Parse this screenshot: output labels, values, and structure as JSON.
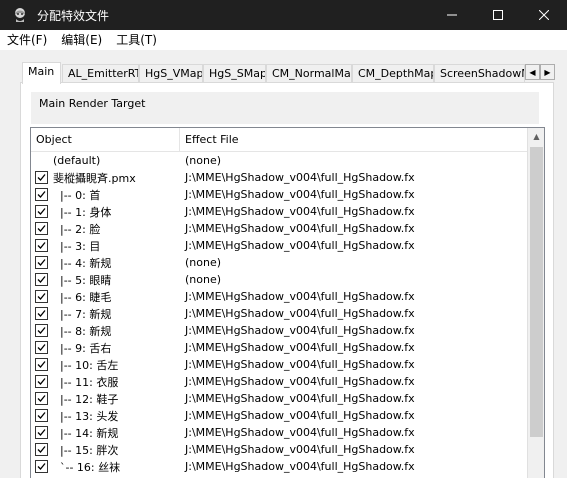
{
  "window": {
    "title": "分配特效文件",
    "minimize_icon": "minimize-icon",
    "maximize_icon": "maximize-icon",
    "close_icon": "close-icon"
  },
  "menu": [
    {
      "label": "文件(F)"
    },
    {
      "label": "编辑(E)"
    },
    {
      "label": "工具(T)"
    }
  ],
  "tabs": [
    {
      "label": "Main",
      "active": true
    },
    {
      "label": "AL_EmitterRT"
    },
    {
      "label": "HgS_VMap"
    },
    {
      "label": "HgS_SMap"
    },
    {
      "label": "CM_NormalMap"
    },
    {
      "label": "CM_DepthMap"
    },
    {
      "label": "ScreenShadowMap"
    }
  ],
  "render_target": {
    "label": "Main Render Target"
  },
  "list": {
    "columns": {
      "object": "Object",
      "effect": "Effect File"
    },
    "rows": [
      {
        "object": "(default)",
        "effect": "(none)",
        "checked": null
      },
      {
        "object": "斐樅攝睍斉.pmx",
        "effect": "J:\\MME\\HgShadow_v004\\full_HgShadow.fx",
        "checked": true
      },
      {
        "object": "  |-- 0: 首",
        "effect": "J:\\MME\\HgShadow_v004\\full_HgShadow.fx",
        "checked": true
      },
      {
        "object": "  |-- 1: 身体",
        "effect": "J:\\MME\\HgShadow_v004\\full_HgShadow.fx",
        "checked": true
      },
      {
        "object": "  |-- 2: 脸",
        "effect": "J:\\MME\\HgShadow_v004\\full_HgShadow.fx",
        "checked": true
      },
      {
        "object": "  |-- 3: 目",
        "effect": "J:\\MME\\HgShadow_v004\\full_HgShadow.fx",
        "checked": true
      },
      {
        "object": "  |-- 4: 新规",
        "effect": "(none)",
        "checked": true
      },
      {
        "object": "  |-- 5: 眼睛",
        "effect": "(none)",
        "checked": true
      },
      {
        "object": "  |-- 6: 睫毛",
        "effect": "J:\\MME\\HgShadow_v004\\full_HgShadow.fx",
        "checked": true
      },
      {
        "object": "  |-- 7: 新规",
        "effect": "J:\\MME\\HgShadow_v004\\full_HgShadow.fx",
        "checked": true
      },
      {
        "object": "  |-- 8: 新规",
        "effect": "J:\\MME\\HgShadow_v004\\full_HgShadow.fx",
        "checked": true
      },
      {
        "object": "  |-- 9: 舌右",
        "effect": "J:\\MME\\HgShadow_v004\\full_HgShadow.fx",
        "checked": true
      },
      {
        "object": "  |-- 10: 舌左",
        "effect": "J:\\MME\\HgShadow_v004\\full_HgShadow.fx",
        "checked": true
      },
      {
        "object": "  |-- 11: 衣服",
        "effect": "J:\\MME\\HgShadow_v004\\full_HgShadow.fx",
        "checked": true
      },
      {
        "object": "  |-- 12: 鞋子",
        "effect": "J:\\MME\\HgShadow_v004\\full_HgShadow.fx",
        "checked": true
      },
      {
        "object": "  |-- 13: 头发",
        "effect": "J:\\MME\\HgShadow_v004\\full_HgShadow.fx",
        "checked": true
      },
      {
        "object": "  |-- 14: 新规",
        "effect": "J:\\MME\\HgShadow_v004\\full_HgShadow.fx",
        "checked": true
      },
      {
        "object": "  |-- 15: 胖次",
        "effect": "J:\\MME\\HgShadow_v004\\full_HgShadow.fx",
        "checked": true
      },
      {
        "object": "  `-- 16: 丝袜",
        "effect": "J:\\MME\\HgShadow_v004\\full_HgShadow.fx",
        "checked": true
      }
    ]
  }
}
